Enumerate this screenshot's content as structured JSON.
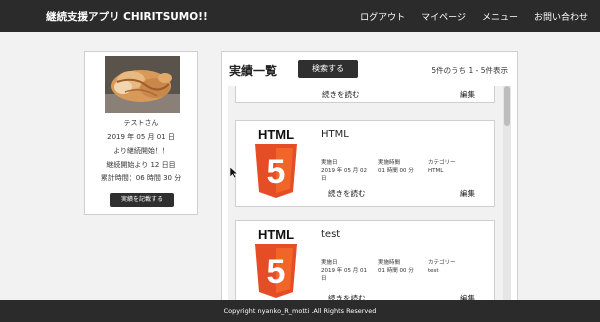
{
  "header": {
    "brand": "継続支援アプリ CHIRITSUMO!!",
    "nav": [
      "ログアウト",
      "マイページ",
      "メニュー",
      "お問い合わせ"
    ]
  },
  "profile": {
    "name": "テストさん",
    "start_date": "2019 年 05 月 01 日",
    "start_note": "より継続開始！！",
    "days": "継続開始より 12 日目",
    "total_time": "累計時間：06 時間 30 分",
    "record_button": "実績を記載する"
  },
  "list": {
    "title": "実績一覧",
    "search_button": "検索する",
    "count": "5件のうち 1 - 5件表示",
    "read_more": "続きを読む",
    "edit": "編集",
    "labels": {
      "date": "実施日",
      "time": "実施時間",
      "category": "カテゴリー"
    },
    "logo_text": "HTML",
    "items": [
      {
        "title": "HTML",
        "date": "2019 年 05 月 02 日",
        "time": "01 時間 00 分",
        "category": "HTML"
      },
      {
        "title": "test",
        "date": "2019 年 05 月 01 日",
        "time": "01 時間 00 分",
        "category": "test"
      }
    ]
  },
  "footer": {
    "copyright": "Copyright nyanko_R_motti .All Rights Reserved"
  }
}
